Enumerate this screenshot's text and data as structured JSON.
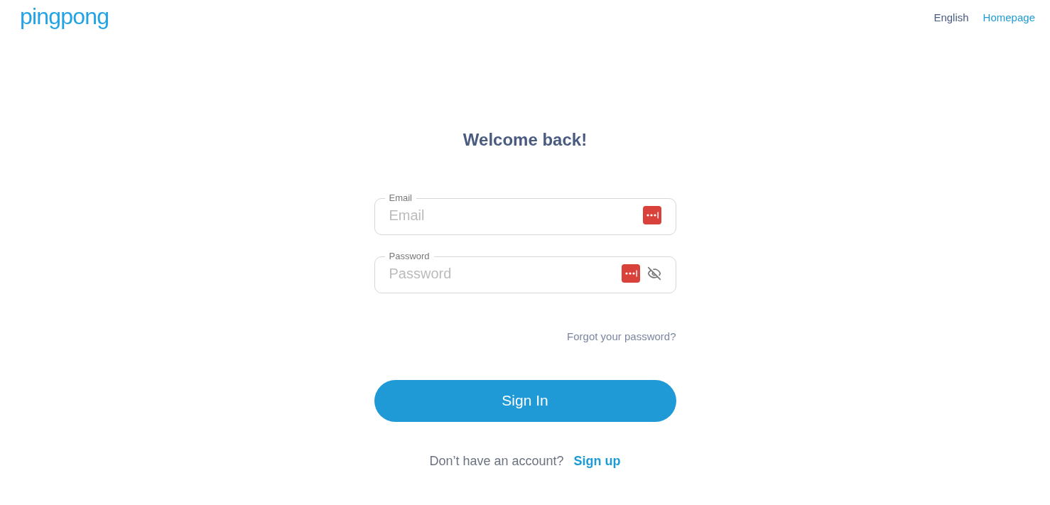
{
  "header": {
    "logo": "pingpong",
    "links": [
      {
        "label": "English",
        "kind": "language"
      },
      {
        "label": "Homepage",
        "kind": "link"
      }
    ]
  },
  "title": "Welcome back!",
  "fields": [
    {
      "kind": "email",
      "label": "Email",
      "placeholder": "Email"
    },
    {
      "kind": "password",
      "label": "Password",
      "placeholder": "Password"
    }
  ],
  "forgot_link": "Forgot your password?",
  "submit": "Sign In",
  "signup": {
    "prompt": "Don’t have an account?",
    "link": "Sign up"
  }
}
